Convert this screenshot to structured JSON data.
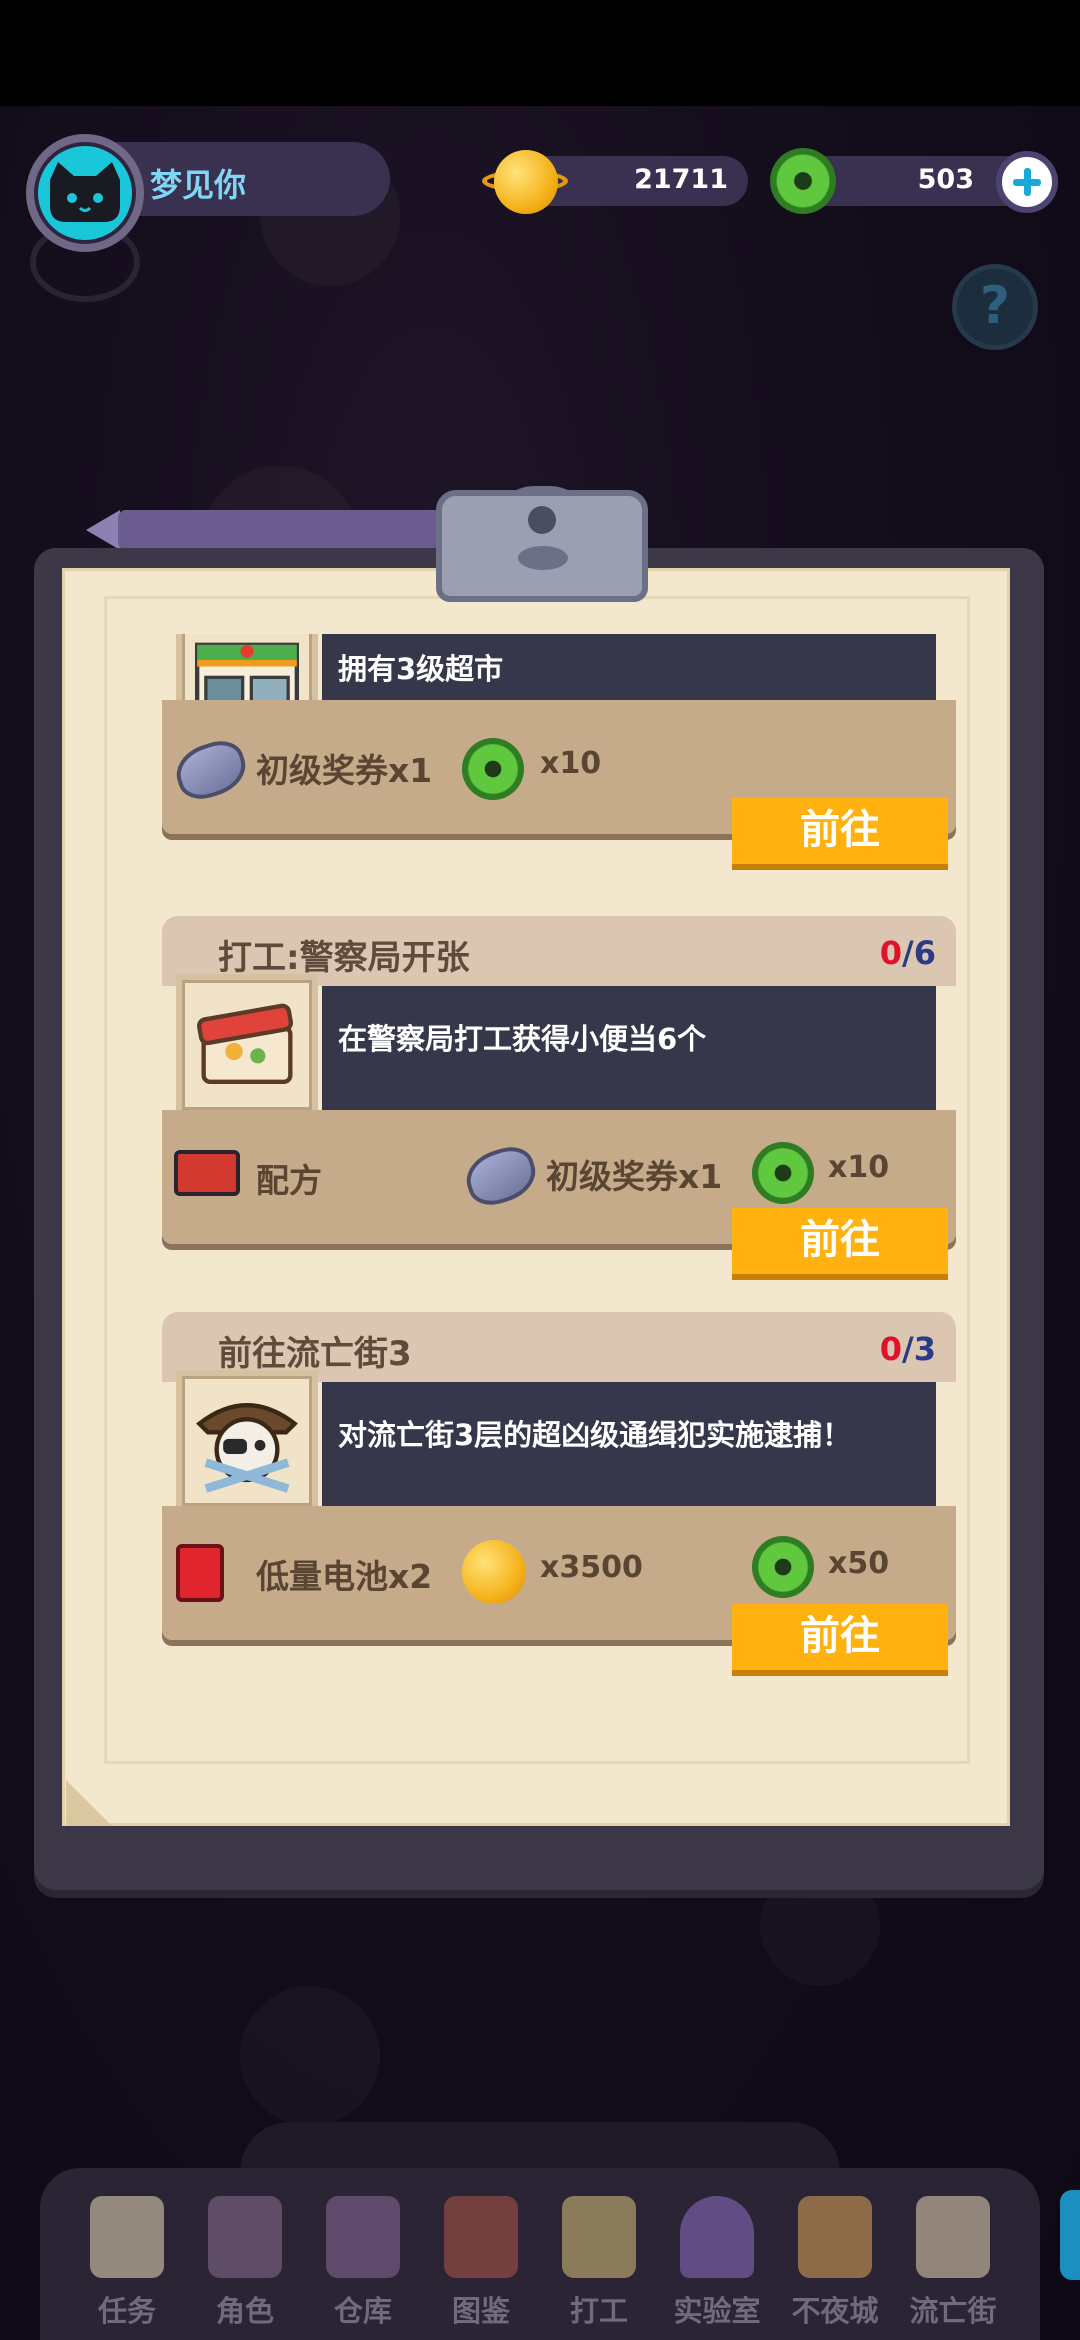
{
  "player": {
    "name": "梦见你"
  },
  "currency": {
    "planet_coins": "21711",
    "donuts": "503"
  },
  "icons": {
    "help": "?",
    "add": "plus-icon"
  },
  "tasks": [
    {
      "title": "",
      "progress_current": "",
      "progress_total": "",
      "description": "拥有3级超市",
      "image": "supermarket-icon",
      "rewards": [
        {
          "icon": "ticket-icon",
          "label": "初级奖券x1"
        },
        {
          "icon": "donut-icon",
          "label": "x10"
        }
      ],
      "button": "前往"
    },
    {
      "title": "打工:警察局开张",
      "progress_current": "0",
      "progress_total": "/6",
      "description": "在警察局打工获得小便当6个",
      "image": "bento-icon",
      "rewards": [
        {
          "icon": "bento-icon",
          "label": "配方"
        },
        {
          "icon": "ticket-icon",
          "label": "初级奖券x1"
        },
        {
          "icon": "donut-icon",
          "label": "x10"
        }
      ],
      "button": "前往"
    },
    {
      "title": "前往流亡街3",
      "progress_current": "0",
      "progress_total": "/3",
      "description": "对流亡街3层的超凶级通缉犯实施逮捕！",
      "image": "pirate-skull-icon",
      "rewards": [
        {
          "icon": "battery-icon",
          "label": "低量电池x2"
        },
        {
          "icon": "planet-coin-icon",
          "label": "x3500"
        },
        {
          "icon": "donut-icon",
          "label": "x50"
        }
      ],
      "button": "前往"
    }
  ],
  "nav": [
    {
      "label": "任务",
      "icon": "task-scroll-icon"
    },
    {
      "label": "角色",
      "icon": "character-cat-icon"
    },
    {
      "label": "仓库",
      "icon": "chest-icon"
    },
    {
      "label": "图鉴",
      "icon": "book-icon"
    },
    {
      "label": "打工",
      "icon": "work-screen-icon"
    },
    {
      "label": "实验室",
      "icon": "lab-dome-icon"
    },
    {
      "label": "不夜城",
      "icon": "night-city-cat-icon"
    },
    {
      "label": "流亡街",
      "icon": "pirate-street-icon"
    }
  ]
}
